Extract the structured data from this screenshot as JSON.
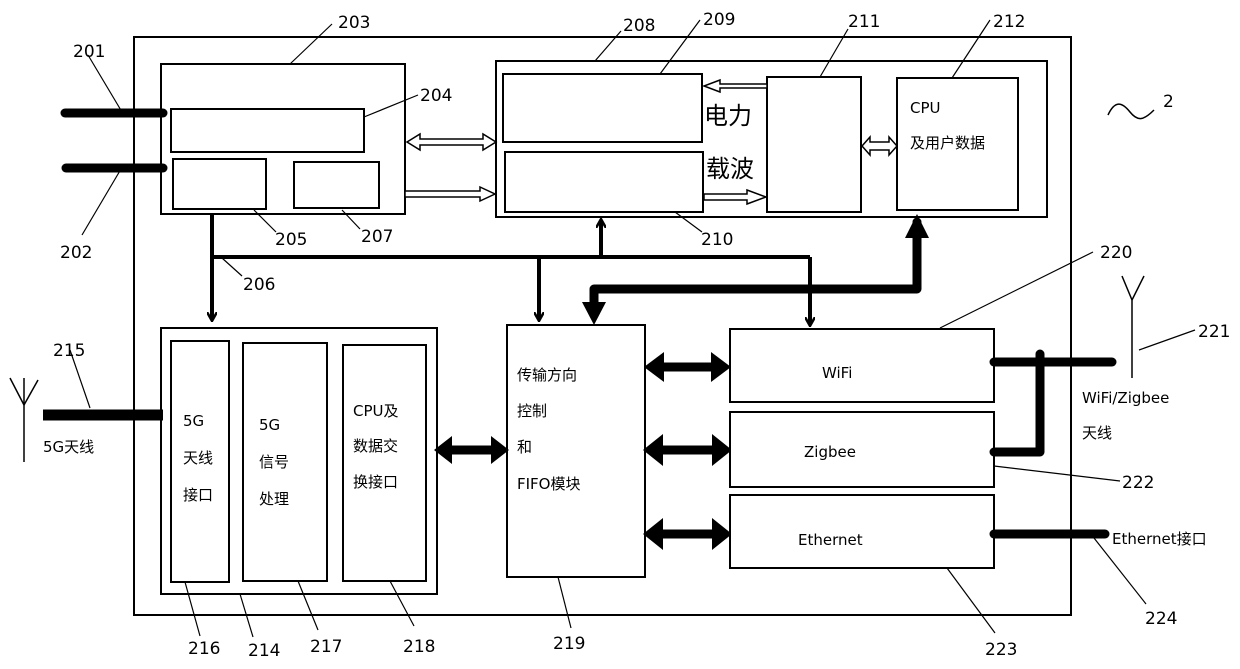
{
  "figure": {
    "figure_number": "2",
    "refs": {
      "r201": "201",
      "r202": "202",
      "r203": "203",
      "r204": "204",
      "r205": "205",
      "r206": "206",
      "r207": "207",
      "r208": "208",
      "r209": "209",
      "r210": "210",
      "r211": "211",
      "r212": "212",
      "r214": "214",
      "r215": "215",
      "r216": "216",
      "r217": "217",
      "r218": "218",
      "r219": "219",
      "r220": "220",
      "r221": "221",
      "r222": "222",
      "r223": "223",
      "r224": "224"
    },
    "power_carrier": {
      "line1": "电力",
      "line2": "载波"
    },
    "cpu_user_data": {
      "line1": "CPU",
      "line2": "及用户数据"
    },
    "module_5g": {
      "antenna_interface": [
        "5G",
        "天线",
        "接口"
      ],
      "signal_processing": [
        "5G",
        "信号",
        "处理"
      ],
      "cpu_exchange": [
        "CPU及",
        "数据交",
        "换接口"
      ]
    },
    "fifo_module": [
      "传输方向",
      "控制",
      "和",
      "FIFO模块"
    ],
    "wifi_label": "WiFi",
    "zigbee_label": "Zigbee",
    "ethernet_label": "Ethernet",
    "antenna_5g_label": "5G天线",
    "antenna_wz_label": [
      "WiFi/Zigbee",
      "天线"
    ],
    "ethernet_port_label": "Ethernet接口"
  }
}
